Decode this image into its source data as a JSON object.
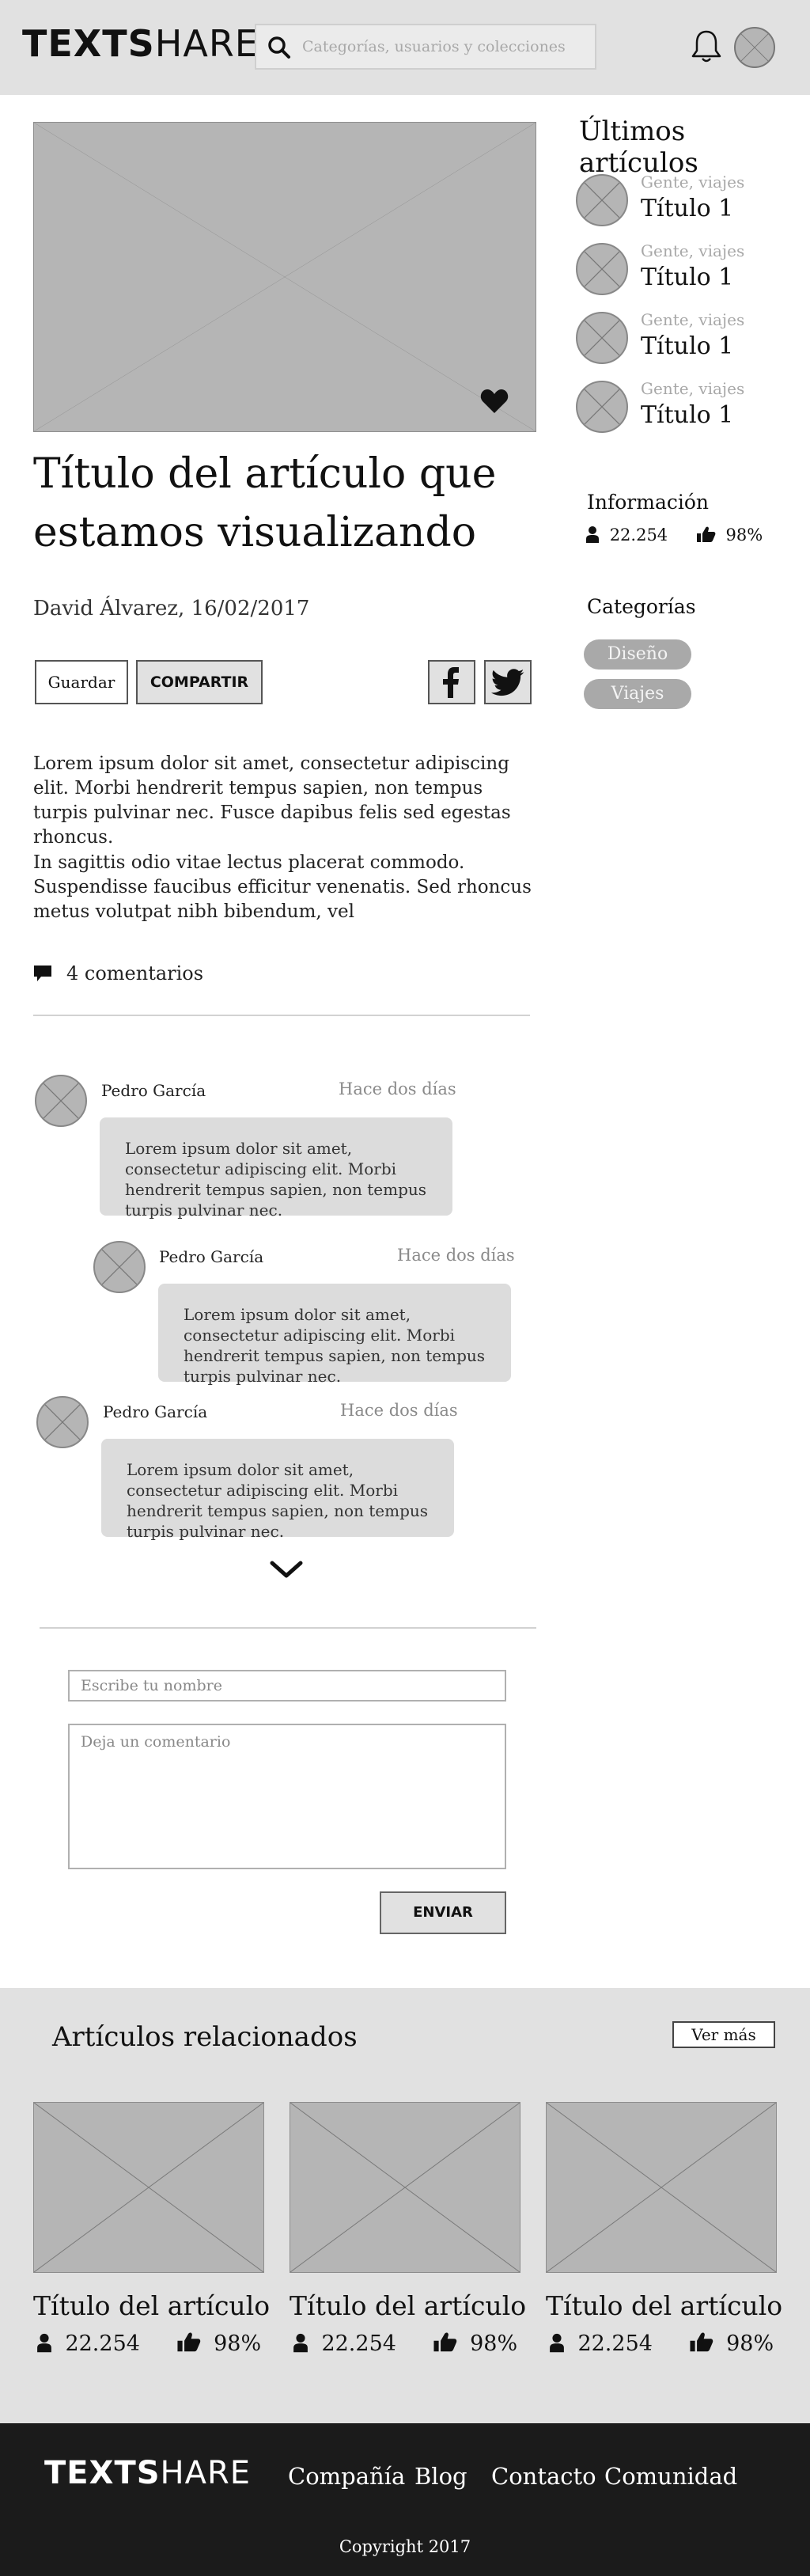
{
  "header": {
    "logo_bold": "TEXTS",
    "logo_light": "HARE",
    "search_placeholder": "Categorías, usuarios y colecciones"
  },
  "article": {
    "title": "Título del artículo que estamos visualizando",
    "byline": "David Álvarez, 16/02/2017",
    "save_label": "Guardar",
    "share_label": "COMPARTIR",
    "paragraph1": "Lorem ipsum dolor sit amet, consectetur adipiscing elit. Morbi hendrerit tempus sapien, non tempus turpis pulvinar nec. Fusce dapibus felis sed egestas rhoncus.",
    "paragraph2": "In sagittis odio vitae lectus placerat commodo. Suspendisse faucibus efficitur venenatis. Sed rhoncus metus volutpat nibh bibendum, vel",
    "comments_count": "4 comentarios"
  },
  "comments": [
    {
      "author": "Pedro García",
      "time": "Hace dos días",
      "text": "Lorem ipsum dolor sit amet, consectetur adipiscing elit. Morbi hendrerit tempus sapien, non tempus turpis pulvinar nec."
    },
    {
      "author": "Pedro García",
      "time": "Hace dos días",
      "text": "Lorem ipsum dolor sit amet, consectetur adipiscing elit. Morbi hendrerit tempus sapien, non tempus turpis pulvinar nec."
    },
    {
      "author": "Pedro García",
      "time": "Hace dos días",
      "text": "Lorem ipsum dolor sit amet, consectetur adipiscing elit. Morbi hendrerit tempus sapien, non tempus turpis pulvinar nec."
    }
  ],
  "comment_form": {
    "name_placeholder": "Escribe tu nombre",
    "comment_placeholder": "Deja un comentario",
    "send_label": "ENVIAR"
  },
  "sidebar": {
    "latest_title": "Últimos artículos",
    "latest": [
      {
        "category": "Gente, viajes",
        "title": "Título 1"
      },
      {
        "category": "Gente, viajes",
        "title": "Título 1"
      },
      {
        "category": "Gente, viajes",
        "title": "Título 1"
      },
      {
        "category": "Gente, viajes",
        "title": "Título 1"
      }
    ],
    "info_title": "Información",
    "views": "22.254",
    "likes": "98%",
    "categories_title": "Categorías",
    "tags": [
      "Diseño",
      "Viajes"
    ]
  },
  "related": {
    "title": "Artículos relacionados",
    "more_label": "Ver más",
    "cards": [
      {
        "title": "Título del artículo",
        "views": "22.254",
        "likes": "98%"
      },
      {
        "title": "Título del artículo",
        "views": "22.254",
        "likes": "98%"
      },
      {
        "title": "Título del artículo",
        "views": "22.254",
        "likes": "98%"
      }
    ]
  },
  "footer": {
    "logo_bold": "TEXTS",
    "logo_light": "HARE",
    "nav": [
      "Compañía",
      "Blog",
      "Contacto",
      "Comunidad"
    ],
    "copyright": "Copyright 2017"
  },
  "colors": {
    "header_bg": "#e1e1e1",
    "footer_bg": "#1b1b1b",
    "placeholder_gray": "#b5b5b5",
    "bubble_bg": "#dcdcdc"
  }
}
